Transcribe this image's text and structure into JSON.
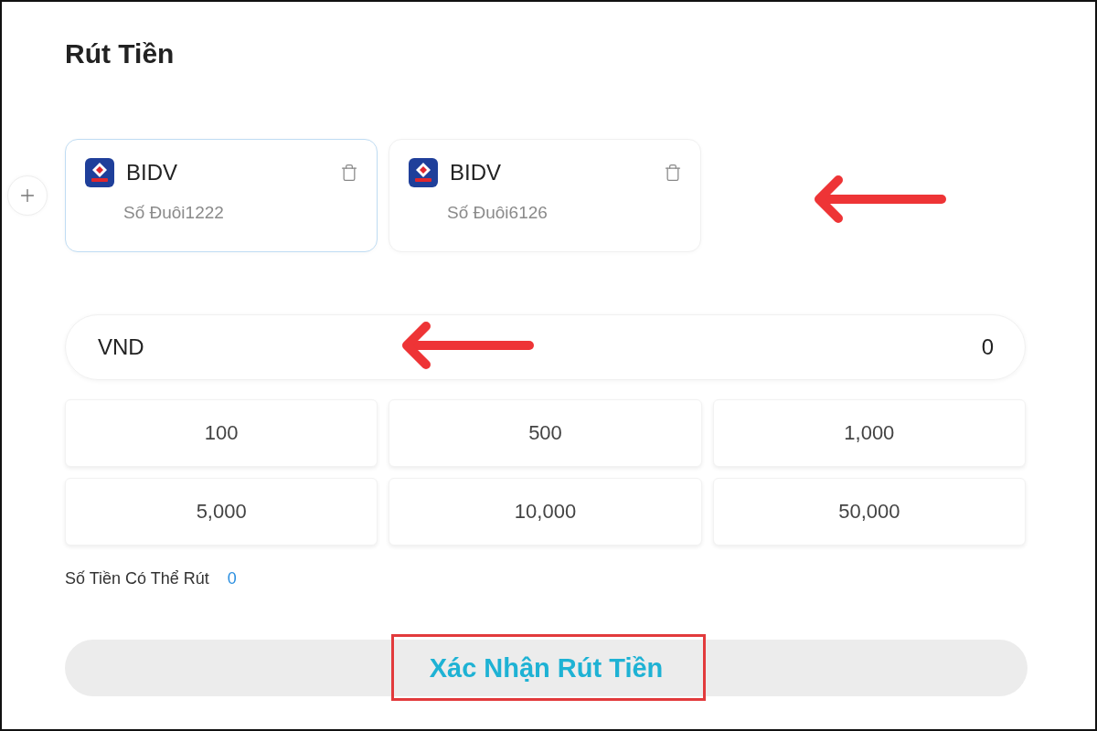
{
  "title": "Rút Tiền",
  "bank_cards": [
    {
      "bank": "BIDV",
      "account_suffix": "Số Đuôi1222",
      "selected": true
    },
    {
      "bank": "BIDV",
      "account_suffix": "Số Đuôi6126",
      "selected": false
    }
  ],
  "amount_field": {
    "currency": "VND",
    "value": "0"
  },
  "quick_amounts": [
    "100",
    "500",
    "1,000",
    "5,000",
    "10,000",
    "50,000"
  ],
  "available": {
    "label": "Số Tiền Có Thể Rút",
    "value": "0"
  },
  "confirm_button": {
    "label": "Xác Nhận Rút Tiền"
  }
}
